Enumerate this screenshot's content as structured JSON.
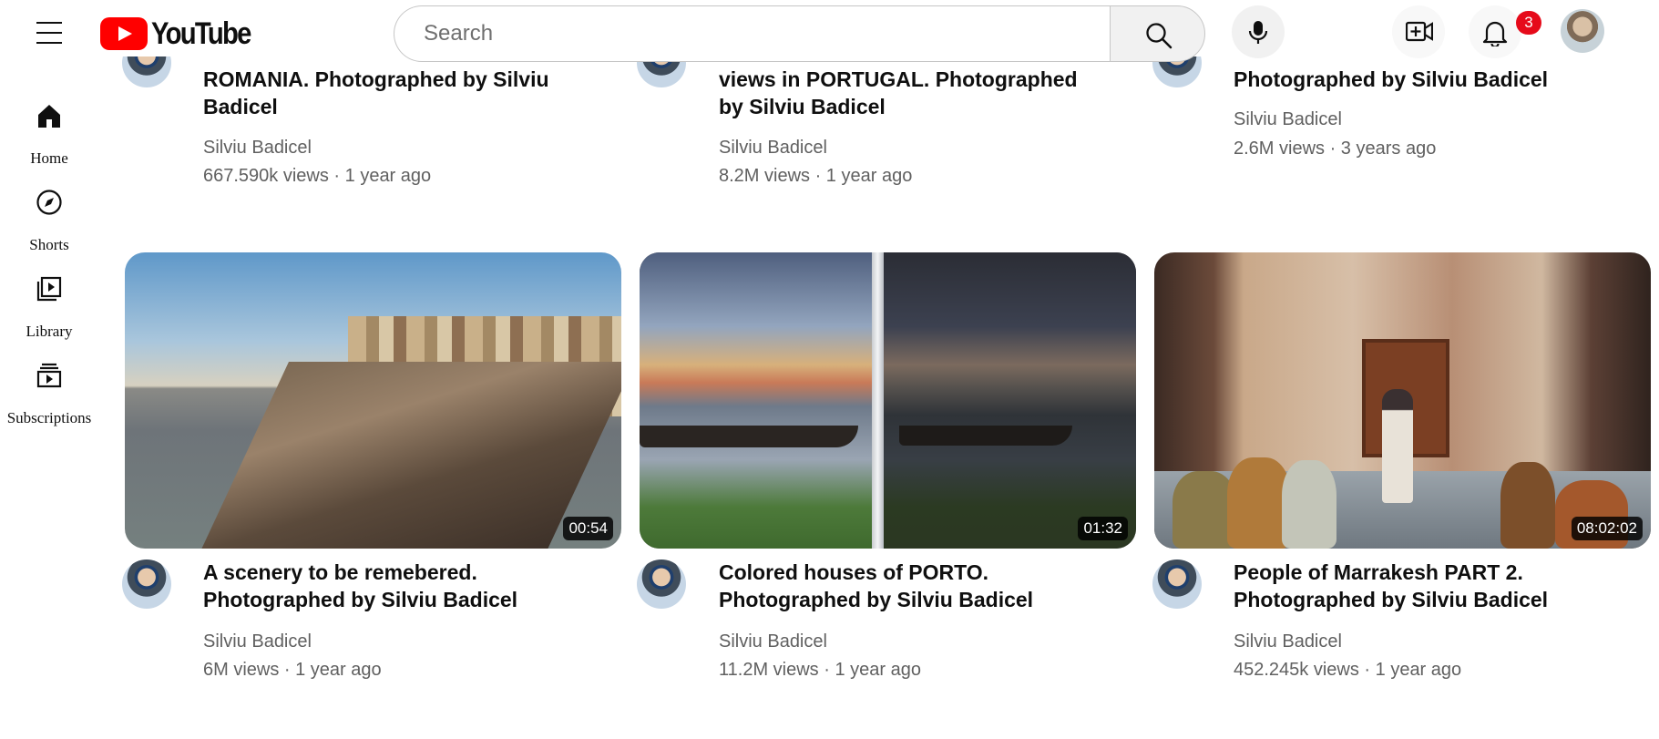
{
  "app": {
    "logo_text": "YouTube"
  },
  "search": {
    "placeholder": "Search"
  },
  "notifications": {
    "count": "3"
  },
  "sidebar": {
    "items": [
      {
        "label": "Home",
        "icon": "home-icon"
      },
      {
        "label": "Shorts",
        "icon": "shorts-icon"
      },
      {
        "label": "Library",
        "icon": "library-icon"
      },
      {
        "label": "Subscriptions",
        "icon": "subscriptions-icon"
      }
    ]
  },
  "videos_top": [
    {
      "title": "ROMANIA. Photographed by Silviu Badicel",
      "channel": "Silviu Badicel",
      "meta": "667.590k views · 1 year ago"
    },
    {
      "title": "views in PORTUGAL. Photographed by Silviu Badicel",
      "channel": "Silviu Badicel",
      "meta": "8.2M views · 1 year ago"
    },
    {
      "title": "Photographed by Silviu Badicel",
      "channel": "Silviu Badicel",
      "meta": "2.6M views · 3 years ago"
    }
  ],
  "videos": [
    {
      "title": "A scenery to be remebered. Photographed by Silviu Badicel",
      "channel": "Silviu Badicel",
      "meta": "6M views · 1 year ago",
      "duration": "00:54"
    },
    {
      "title": "Colored houses of PORTO. Photographed by Silviu Badicel",
      "channel": "Silviu Badicel",
      "meta": "11.2M views · 1 year ago",
      "duration": "01:32"
    },
    {
      "title": "People of Marrakesh PART 2. Photographed by Silviu Badicel",
      "channel": "Silviu Badicel",
      "meta": "452.245k views · 1 year ago",
      "duration": "08:02:02"
    }
  ]
}
